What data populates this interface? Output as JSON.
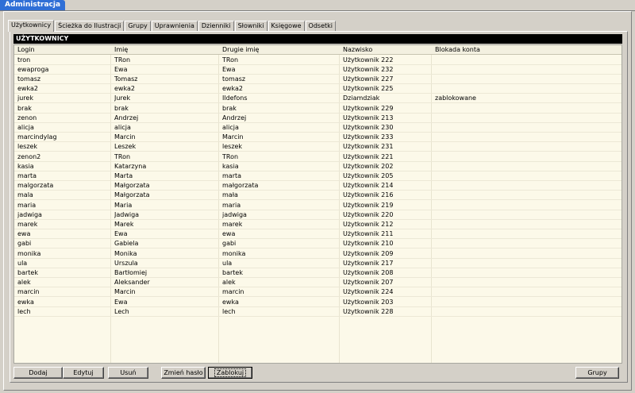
{
  "window": {
    "title": "Administracja"
  },
  "tabs": [
    {
      "label": "Użytkownicy",
      "active": true
    },
    {
      "label": "Ścieżka do Ilustracji"
    },
    {
      "label": "Grupy"
    },
    {
      "label": "Uprawnienia"
    },
    {
      "label": "Dzienniki"
    },
    {
      "label": "Słowniki"
    },
    {
      "label": "Księgowe"
    },
    {
      "label": "Odsetki"
    }
  ],
  "section": {
    "title": "UŻYTKOWNICY"
  },
  "table": {
    "columns": [
      "Login",
      "Imię",
      "Drugie imię",
      "Nazwisko",
      "Blokada konta"
    ],
    "rows": [
      [
        "tron",
        "TRon",
        "TRon",
        "Użytkownik 222",
        ""
      ],
      [
        "ewaproga",
        "Ewa",
        "Ewa",
        "Użytkownik 232",
        ""
      ],
      [
        "tomasz",
        "Tomasz",
        "tomasz",
        "Użytkownik 227",
        ""
      ],
      [
        "ewka2",
        "ewka2",
        "ewka2",
        "Użytkownik 225",
        ""
      ],
      [
        "jurek",
        "Jurek",
        "Ildefons",
        "Dziamdziak",
        "zablokowane"
      ],
      [
        "brak",
        "brak",
        "brak",
        "Użytkownik 229",
        ""
      ],
      [
        "zenon",
        "Andrzej",
        "Andrzej",
        "Użytkownik 213",
        ""
      ],
      [
        "alicja",
        "alicja",
        "alicja",
        "Użytkownik 230",
        ""
      ],
      [
        "marcindylag",
        "Marcin",
        "Marcin",
        "Użytkownik 233",
        ""
      ],
      [
        "leszek",
        "Leszek",
        "leszek",
        "Użytkownik 231",
        ""
      ],
      [
        "zenon2",
        "TRon",
        "TRon",
        "Użytkownik 221",
        ""
      ],
      [
        "kasia",
        "Katarzyna",
        "kasia",
        "Użytkownik 202",
        ""
      ],
      [
        "marta",
        "Marta",
        "marta",
        "Użytkownik 205",
        ""
      ],
      [
        "malgorzata",
        "Małgorzata",
        "małgorzata",
        "Użytkownik 214",
        ""
      ],
      [
        "mala",
        "Małgorzata",
        "mała",
        "Użytkownik 216",
        ""
      ],
      [
        "maria",
        "Maria",
        "maria",
        "Użytkownik 219",
        ""
      ],
      [
        "jadwiga",
        "Jadwiga",
        "jadwiga",
        "Użytkownik 220",
        ""
      ],
      [
        "marek",
        "Marek",
        "marek",
        "Użytkownik 212",
        ""
      ],
      [
        "ewa",
        "Ewa",
        "ewa",
        "Użytkownik 211",
        ""
      ],
      [
        "gabi",
        "Gabiela",
        "gabi",
        "Użytkownik 210",
        ""
      ],
      [
        "monika",
        "Monika",
        "monika",
        "Użytkownik 209",
        ""
      ],
      [
        "ula",
        "Urszula",
        "ula",
        "Użytkownik 217",
        ""
      ],
      [
        "bartek",
        "Bartłomiej",
        "bartek",
        "Użytkownik 208",
        ""
      ],
      [
        "alek",
        "Aleksander",
        "alek",
        "Użytkownik 207",
        ""
      ],
      [
        "marcin",
        "Marcin",
        "marcin",
        "Użytkownik 224",
        ""
      ],
      [
        "ewka",
        "Ewa",
        "ewka",
        "Użytkownik 203",
        ""
      ],
      [
        "lech",
        "Lech",
        "lech",
        "Użytkownik 228",
        ""
      ]
    ]
  },
  "buttons": {
    "add": "Dodaj",
    "edit": "Edytuj",
    "delete": "Usuń",
    "change_password": "Zmień hasło",
    "lock": "Zablokuj",
    "groups": "Grupy"
  }
}
